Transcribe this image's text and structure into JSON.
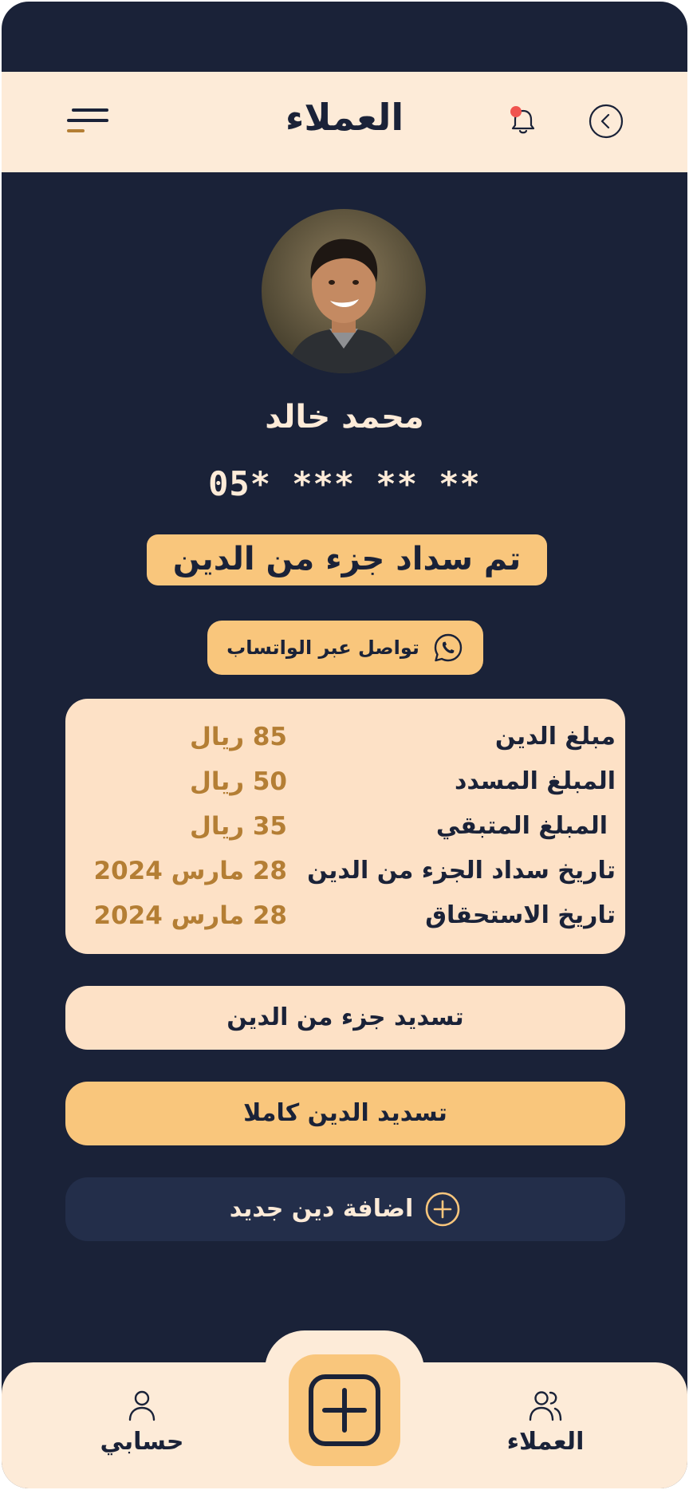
{
  "header": {
    "title": "العملاء",
    "menu_icon": "menu-icon",
    "notification_icon": "bell-icon",
    "back_icon": "chevron-left-icon"
  },
  "profile": {
    "avatar": "avatar-photo",
    "name": "محمد خالد",
    "phone": "05* *** ** **",
    "status": "تم سداد جزء من الدين"
  },
  "contact": {
    "whatsapp_label": "تواصل عبر الواتساب",
    "icon": "whatsapp-icon"
  },
  "details": [
    {
      "label": "مبلغ الدين",
      "value": "85 ريال"
    },
    {
      "label": "المبلغ المسدد",
      "value": "50 ريال"
    },
    {
      "label": "المبلغ المتبقي",
      "value": "35 ريال"
    },
    {
      "label": "تاريخ سداد الجزء من الدين",
      "value": "28 مارس 2024"
    },
    {
      "label": "تاريخ الاستحقاق",
      "value": "28 مارس 2024"
    }
  ],
  "actions": {
    "pay_partial": "تسديد جزء من الدين",
    "pay_full": "تسديد الدين كاملا",
    "add_debt": "اضافة دين جديد"
  },
  "nav": {
    "account": "حسابي",
    "customers": "العملاء",
    "add_icon": "plus-square-icon"
  },
  "colors": {
    "background": "#1a2238",
    "cream": "#fdebd8",
    "peach": "#fde1c6",
    "accent": "#f9c67c",
    "gold": "#b47e34",
    "notification": "#f0544f"
  }
}
